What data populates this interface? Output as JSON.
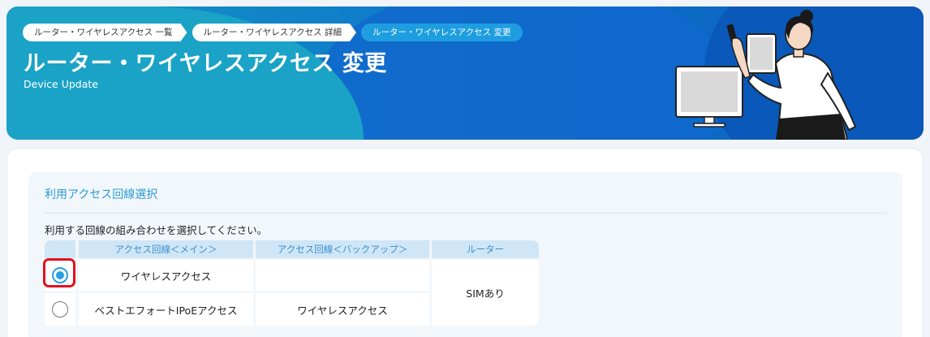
{
  "breadcrumb": [
    {
      "label": "ルーター・ワイヤレスアクセス 一覧"
    },
    {
      "label": "ルーター・ワイヤレスアクセス 詳細"
    },
    {
      "label": "ルーター・ワイヤレスアクセス 変更"
    }
  ],
  "header": {
    "title": "ルーター・ワイヤレスアクセス 変更",
    "subtitle": "Device Update"
  },
  "section": {
    "title": "利用アクセス回線選択",
    "instruction": "利用する回線の組み合わせを選択してください。"
  },
  "table": {
    "columns": [
      "",
      "アクセス回線＜メイン＞",
      "アクセス回線＜バックアップ＞",
      "ルーター"
    ],
    "rows": [
      {
        "selected": true,
        "main": "ワイヤレスアクセス",
        "backup": ""
      },
      {
        "selected": false,
        "main": "ベストエフォートIPoEアクセス",
        "backup": "ワイヤレスアクセス"
      }
    ],
    "router": "SIMあり"
  },
  "colors": {
    "accent": "#2aa0e4",
    "header_bg": "#cfe6f6",
    "highlight": "#e3101e"
  }
}
